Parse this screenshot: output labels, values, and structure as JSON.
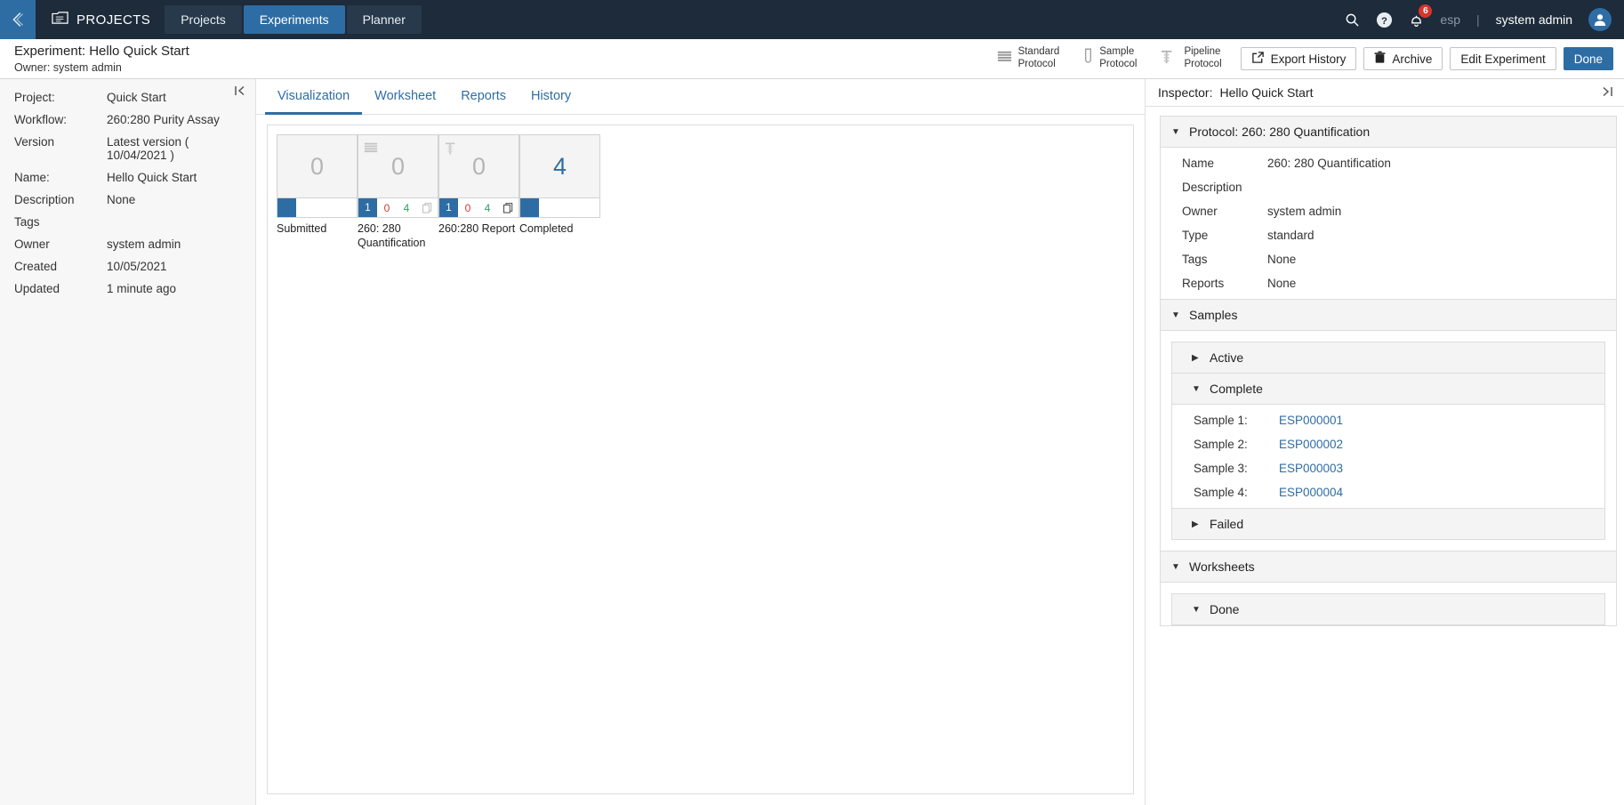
{
  "topnav": {
    "back_icon": "back-chevron-icon",
    "brand_icon": "projects-folder-icon",
    "brand": "PROJECTS",
    "tabs": [
      {
        "label": "Projects",
        "active": false
      },
      {
        "label": "Experiments",
        "active": true
      },
      {
        "label": "Planner",
        "active": false
      }
    ],
    "search_icon": "search-icon",
    "help_icon": "help-icon",
    "bell_icon": "bell-icon",
    "notification_count": "6",
    "locale": "esp",
    "separator": "|",
    "user": "system admin",
    "avatar_icon": "user-avatar-icon"
  },
  "subheader": {
    "title": "Experiment: Hello Quick Start",
    "owner": "Owner: system admin",
    "protocol_buttons": [
      {
        "icon": "standard-protocol-icon",
        "line1": "Standard",
        "line2": "Protocol"
      },
      {
        "icon": "sample-protocol-icon",
        "line1": "Sample",
        "line2": "Protocol"
      },
      {
        "icon": "pipeline-protocol-icon",
        "line1": "Pipeline",
        "line2": "Protocol"
      }
    ],
    "export_history": "Export History",
    "archive": "Archive",
    "edit_experiment": "Edit Experiment",
    "done": "Done"
  },
  "left_panel": {
    "collapse_icon": "collapse-left-icon",
    "properties": [
      {
        "key": "Project:",
        "value": "Quick Start"
      },
      {
        "key": "Workflow:",
        "value": "260:280 Purity Assay"
      },
      {
        "key": "Version",
        "value": "Latest version ( 10/04/2021 )"
      },
      {
        "key": "Name:",
        "value": "Hello Quick Start"
      },
      {
        "key": "Description",
        "value": "None"
      },
      {
        "key": "Tags",
        "value": ""
      },
      {
        "key": "Owner",
        "value": "system admin"
      },
      {
        "key": "Created",
        "value": "10/05/2021"
      },
      {
        "key": "Updated",
        "value": "1 minute ago"
      }
    ]
  },
  "center": {
    "tabs": [
      {
        "label": "Visualization",
        "active": true
      },
      {
        "label": "Worksheet",
        "active": false
      },
      {
        "label": "Reports",
        "active": false
      },
      {
        "label": "History",
        "active": false
      }
    ],
    "workflow_nodes": [
      {
        "label": "Submitted",
        "count": "0",
        "icon": null,
        "queued": "",
        "failed": null,
        "complete": null,
        "copy_icon": null
      },
      {
        "label": "260: 280 Quantification",
        "count": "0",
        "icon": "standard-protocol-icon",
        "queued": "1",
        "failed": "0",
        "complete": "4",
        "copy_icon": "copy-icon"
      },
      {
        "label": "260:280 Report",
        "count": "0",
        "icon": "pipeline-protocol-icon",
        "queued": "1",
        "failed": "0",
        "complete": "4",
        "copy_icon": "copy-icon"
      },
      {
        "label": "Completed",
        "count": "4",
        "icon": null,
        "queued": "",
        "failed": null,
        "complete": null,
        "copy_icon": null
      }
    ]
  },
  "inspector": {
    "header_label": "Inspector:",
    "header_title": "Hello Quick Start",
    "collapse_icon": "collapse-right-icon",
    "protocol_section": {
      "title": "Protocol: 260: 280 Quantification",
      "rows": [
        {
          "key": "Name",
          "value": "260: 280 Quantification"
        },
        {
          "key": "Description",
          "value": ""
        },
        {
          "key": "Owner",
          "value": "system admin"
        },
        {
          "key": "Type",
          "value": "standard"
        },
        {
          "key": "Tags",
          "value": "None"
        },
        {
          "key": "Reports",
          "value": "None"
        }
      ]
    },
    "samples_section": {
      "title": "Samples",
      "active_title": "Active",
      "complete_title": "Complete",
      "failed_title": "Failed",
      "samples": [
        {
          "key": "Sample 1:",
          "value": "ESP000001"
        },
        {
          "key": "Sample 2:",
          "value": "ESP000002"
        },
        {
          "key": "Sample 3:",
          "value": "ESP000003"
        },
        {
          "key": "Sample 4:",
          "value": "ESP000004"
        }
      ]
    },
    "worksheets_section": {
      "title": "Worksheets",
      "done_title": "Done"
    }
  },
  "colors": {
    "nav_bg": "#1d2b3a",
    "accent": "#2e6da4",
    "badge_red": "#d9342b",
    "fail_red": "#cc3b30",
    "complete_green": "#2e9e5b",
    "panel_bg": "#f7f7f7"
  }
}
